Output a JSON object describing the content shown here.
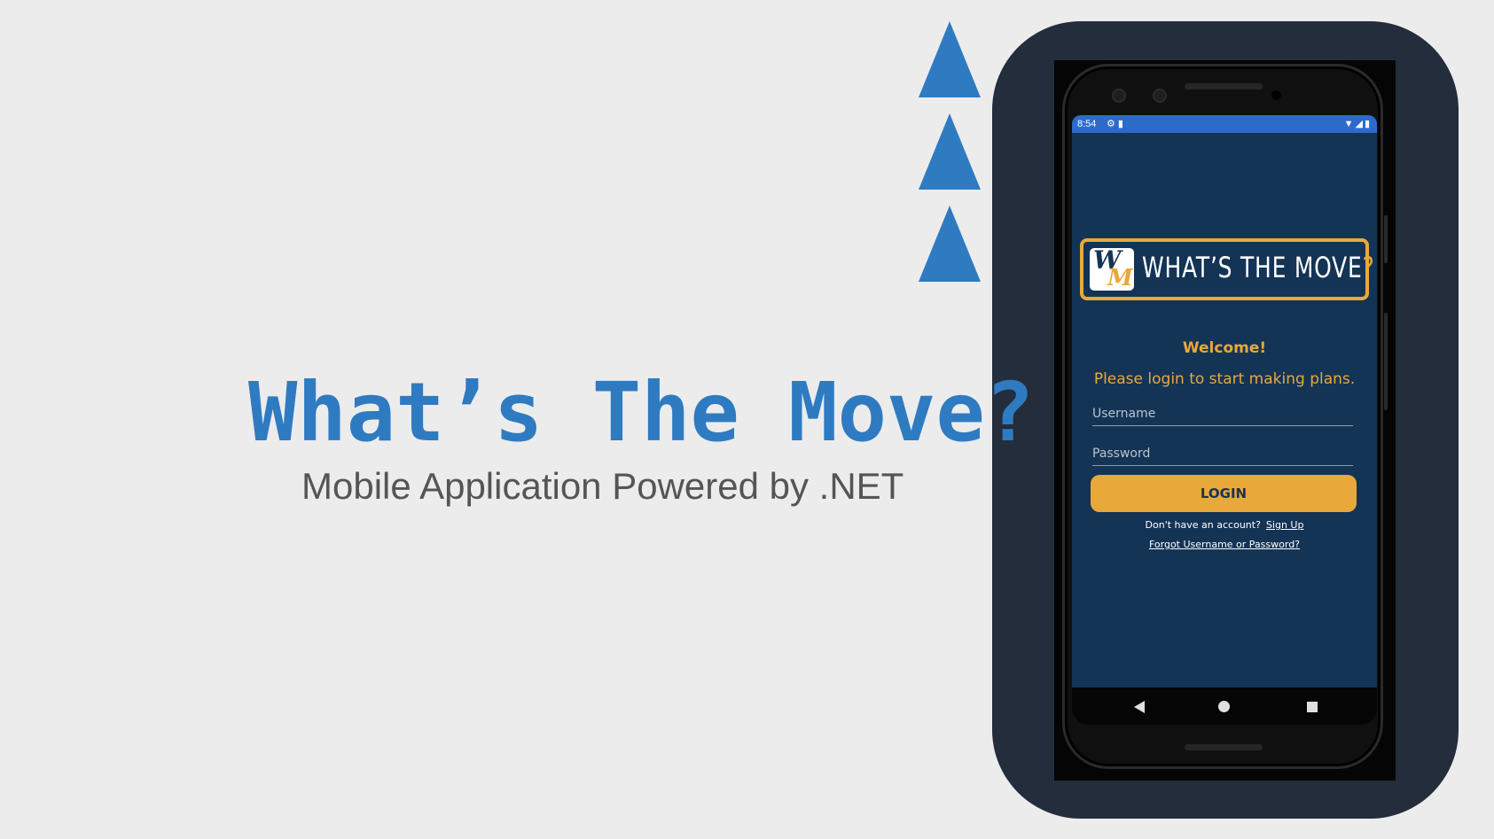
{
  "slide": {
    "title": "What’s The Move?",
    "subtitle": "Mobile Application Powered by .NET"
  },
  "colors": {
    "accent_blue": "#2f7bc1",
    "app_background": "#143456",
    "app_gold": "#e8a93a",
    "panel_dark": "#232d3c",
    "status_bar": "#2d6bcb"
  },
  "phone": {
    "status_bar": {
      "time": "8:54",
      "left_icons": [
        "settings-icon",
        "sd-card-icon"
      ],
      "right_icons": [
        "wifi-icon",
        "signal-icon",
        "battery-icon"
      ]
    },
    "logo": {
      "mark_w": "W",
      "mark_m": "M",
      "text": "WHAT’S THE MOVE",
      "question": "?"
    },
    "welcome": "Welcome!",
    "tagline": "Please login to start making plans.",
    "username": {
      "placeholder": "Username",
      "value": ""
    },
    "password": {
      "placeholder": "Password",
      "value": ""
    },
    "login_button": "LOGIN",
    "signup_prompt": "Don't have an account?",
    "signup_link": "Sign Up",
    "forgot_link": "Forgot Username or Password?",
    "nav": [
      "back-icon",
      "home-icon",
      "recents-icon"
    ]
  }
}
